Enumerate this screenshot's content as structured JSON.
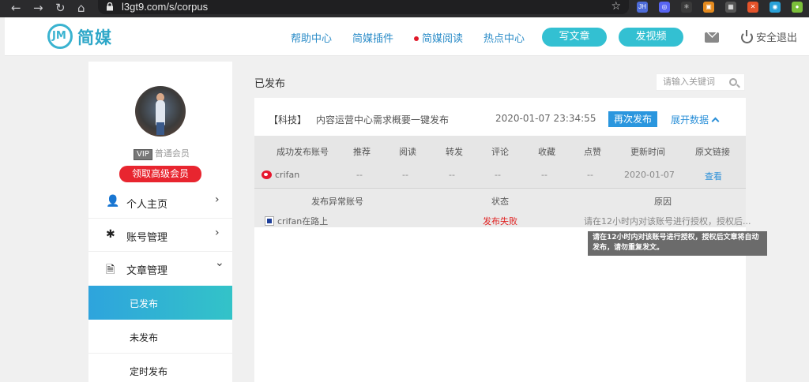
{
  "browser": {
    "url": "l3gt9.com/s/corpus",
    "nav": {
      "back": "←",
      "forward": "→",
      "reload": "↻",
      "home": "⌂",
      "star": "☆"
    },
    "extensions": [
      {
        "name": "jh-extension-icon",
        "text": "JH",
        "color": "#4d6bd8"
      },
      {
        "name": "extension-icon-2",
        "text": "◎",
        "color": "#5865f2"
      },
      {
        "name": "react-icon",
        "text": "⚛",
        "color": "#3a3a3a"
      },
      {
        "name": "extension-icon-4",
        "text": "▣",
        "color": "#e48a1e"
      },
      {
        "name": "qr-icon",
        "text": "▦",
        "color": "#555"
      },
      {
        "name": "extension-icon-6",
        "text": "✕",
        "color": "#e5532a"
      },
      {
        "name": "extension-icon-7",
        "text": "◉",
        "color": "#2aa1d8"
      },
      {
        "name": "extension-icon-8",
        "text": "●",
        "color": "#7bbf3a"
      }
    ]
  },
  "header": {
    "logo_text": "简媒",
    "logo_mark": "JM",
    "nav": [
      "帮助中心",
      "简媒插件",
      "简媒阅读",
      "热点中心"
    ],
    "write_button": "写文章",
    "video_button": "发视频",
    "logout": "安全退出"
  },
  "sidebar": {
    "vip_badge": "VIP",
    "member_level": "普通会员",
    "vip_button": "领取高级会员",
    "menu": [
      {
        "label": "个人主页",
        "icon": "person-icon",
        "glyph": "👤",
        "chevron": "›"
      },
      {
        "label": "账号管理",
        "icon": "gear-icon",
        "glyph": "✱",
        "chevron": "›"
      },
      {
        "label": "文章管理",
        "icon": "document-icon",
        "glyph": "🗎",
        "chevron": "⌄"
      }
    ],
    "sub_items": [
      "已发布",
      "未发布",
      "定时发布"
    ]
  },
  "main": {
    "title": "已发布",
    "search_placeholder": "请输入关键词",
    "article": {
      "category": "【科技】",
      "title": "内容运营中心需求概要一键发布",
      "time": "2020-01-07 23:34:55",
      "republish": "再次发布",
      "expand": "展开数据"
    },
    "stats_headers": [
      "成功发布账号",
      "推荐",
      "阅读",
      "转发",
      "评论",
      "收藏",
      "点赞",
      "更新时间",
      "原文链接"
    ],
    "stats_row": [
      "crifan",
      "--",
      "--",
      "--",
      "--",
      "--",
      "--",
      "2020-01-07",
      "查看"
    ],
    "error_headers": [
      "发布异常账号",
      "状态",
      "原因"
    ],
    "error_row": [
      "crifan在路上",
      "发布失败",
      "请在12小时内对该账号进行授权，授权后..."
    ],
    "tooltip": "请在12小时内对该账号进行授权，授权后文章将自动发布，请勿重复发文。"
  }
}
